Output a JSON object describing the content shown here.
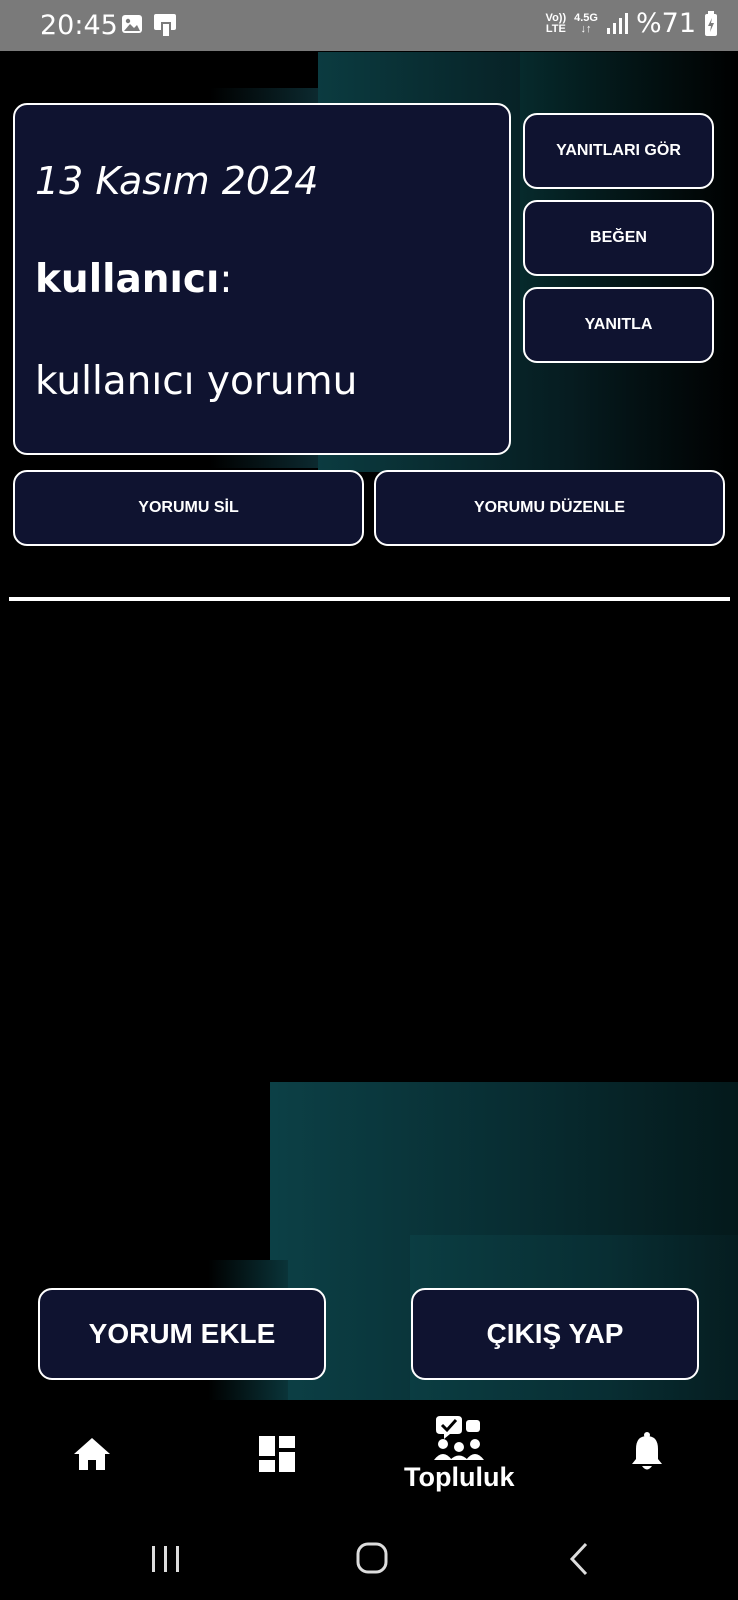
{
  "status_bar": {
    "time": "20:45",
    "network_top": "Vo))",
    "network_bottom": "LTE",
    "data_top": "4.5G",
    "data_bottom": "↓↑",
    "battery": "%71"
  },
  "comment": {
    "date": "13 Kasım 2024",
    "user_label": "kullanıcı",
    "user_suffix": ":",
    "text": "kullanıcı yorumu"
  },
  "comment_actions": {
    "view_replies": "YANITLARI GÖR",
    "like": "BEĞEN",
    "reply": "YANITLA",
    "delete": "YORUMU SİL",
    "edit": "YORUMU DÜZENLE"
  },
  "main_actions": {
    "add_comment": "YORUM EKLE",
    "logout": "ÇIKIŞ YAP"
  },
  "bottom_nav": {
    "items": [
      {
        "icon": "home-icon",
        "label": ""
      },
      {
        "icon": "dashboard-icon",
        "label": ""
      },
      {
        "icon": "community-icon",
        "label": "Topluluk",
        "active": true
      },
      {
        "icon": "bell-icon",
        "label": ""
      }
    ]
  },
  "colors": {
    "card_bg": "#0f1330",
    "accent_teal": "#0c4046",
    "status_bar": "#7a7a7a"
  }
}
